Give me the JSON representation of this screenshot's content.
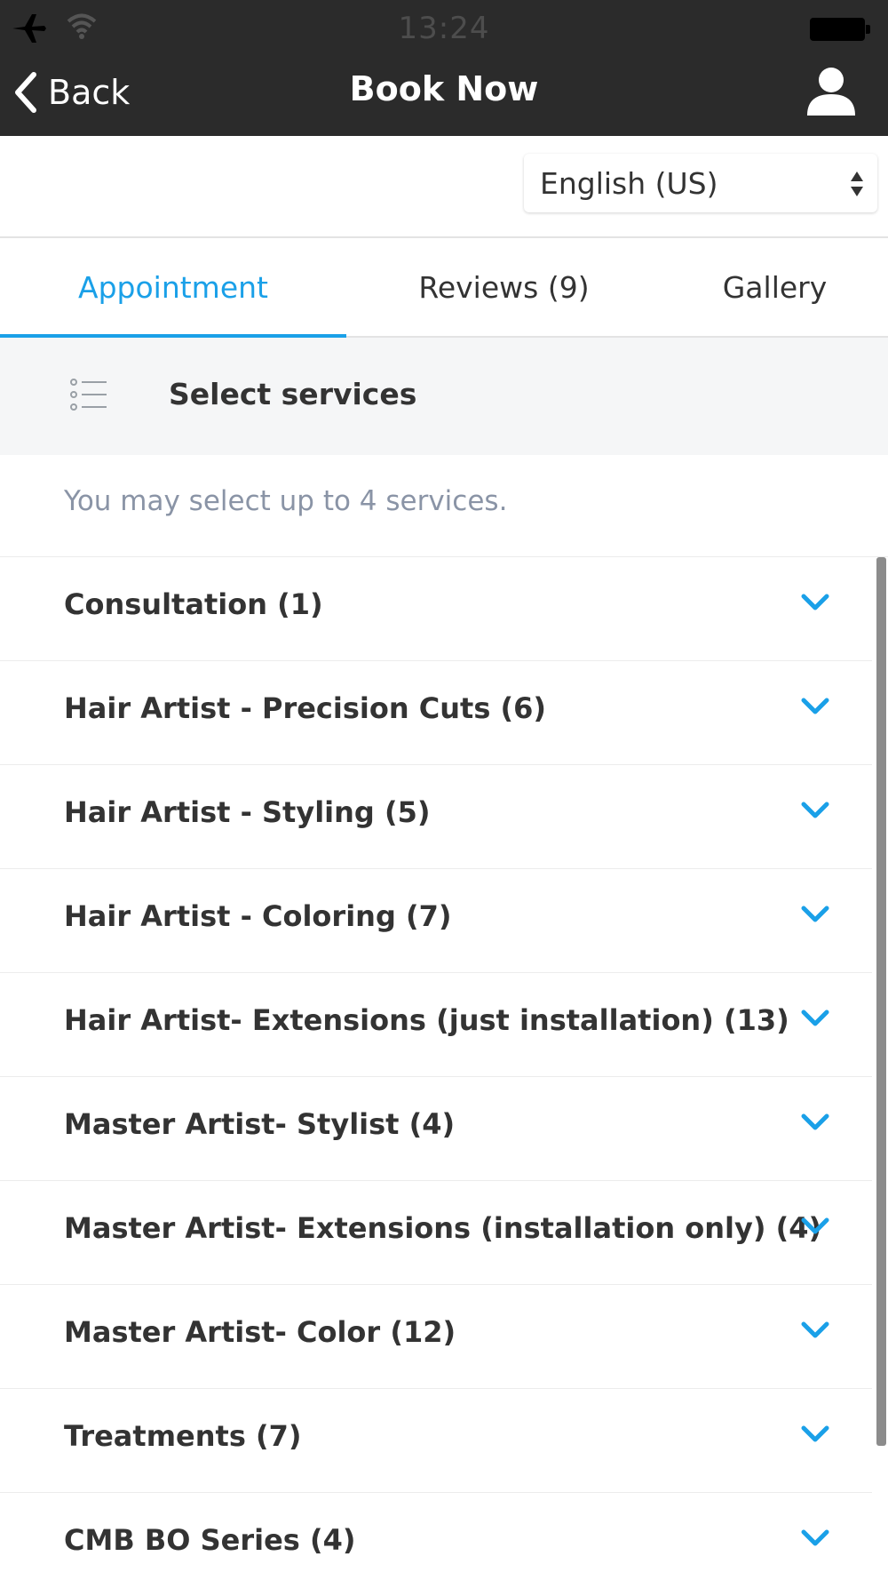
{
  "status_bar": {
    "time": "13:24"
  },
  "navbar": {
    "back_label": "Back",
    "title": "Book Now"
  },
  "language": {
    "selected": "English (US)"
  },
  "tabs": [
    {
      "label": "Appointment",
      "active": true
    },
    {
      "label": "Reviews (9)",
      "active": false
    },
    {
      "label": "Gallery",
      "active": false
    }
  ],
  "section": {
    "title": "Select services",
    "hint": "You may select up to 4 services."
  },
  "services": [
    {
      "label": "Consultation (1)"
    },
    {
      "label": "Hair Artist - Precision Cuts (6)"
    },
    {
      "label": "Hair Artist - Styling (5)"
    },
    {
      "label": "Hair Artist - Coloring (7)"
    },
    {
      "label": "Hair Artist- Extensions (just installation) (13)"
    },
    {
      "label": "Master Artist- Stylist (4)"
    },
    {
      "label": "Master Artist- Extensions (installation only) (4)"
    },
    {
      "label": "Master Artist- Color (12)"
    },
    {
      "label": "Treatments (7)"
    },
    {
      "label": "CMB BO Series (4)"
    }
  ],
  "colors": {
    "accent": "#1aa0e8",
    "topbar": "#2b2b2b",
    "section_bg": "#f5f6f7",
    "hint_text": "#8a94a6"
  }
}
